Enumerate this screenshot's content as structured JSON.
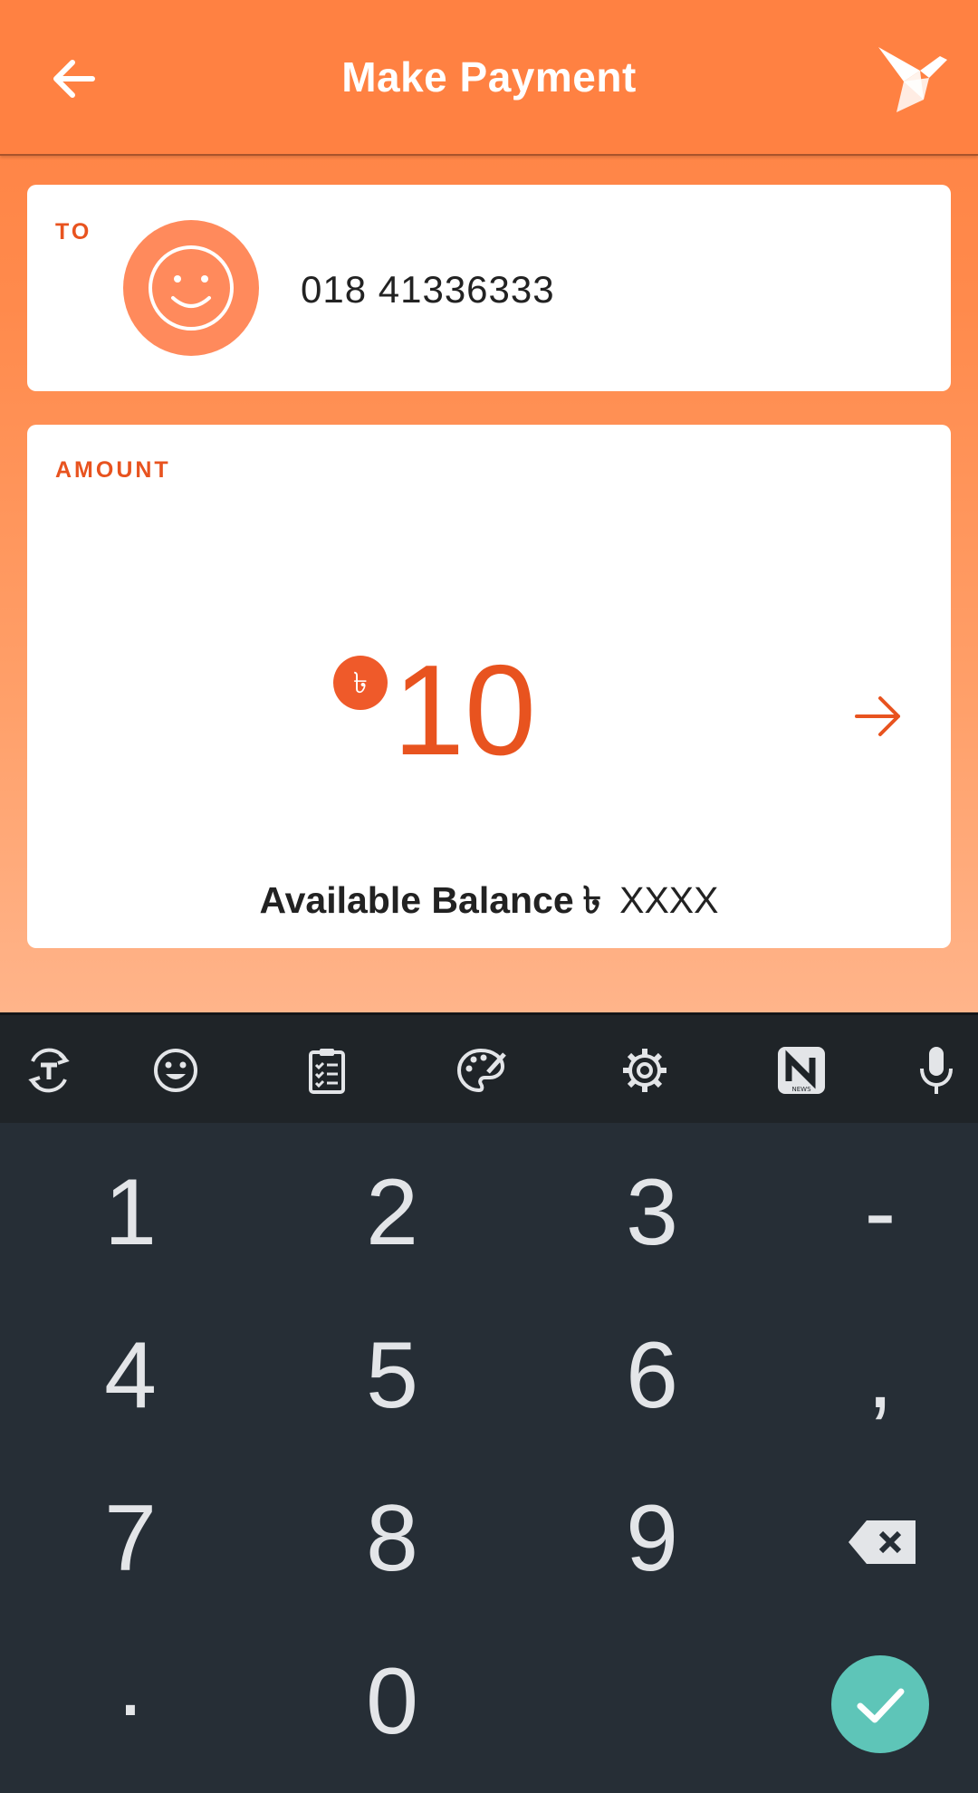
{
  "header": {
    "title": "Make Payment"
  },
  "to_card": {
    "label": "TO",
    "phone": "018 41336333"
  },
  "amount_card": {
    "label": "AMOUNT",
    "currency_symbol": "৳",
    "amount": "10",
    "balance_label": "Available Balance",
    "balance_currency": "৳",
    "balance_value": "XXXX"
  },
  "keyboard": {
    "toolbar_icons": [
      "translate-icon",
      "emoji-icon",
      "clipboard-icon",
      "palette-icon",
      "settings-icon",
      "news-icon",
      "microphone-icon"
    ],
    "keys": {
      "k1": "1",
      "k2": "2",
      "k3": "3",
      "dash": "-",
      "k4": "4",
      "k5": "5",
      "k6": "6",
      "comma": ",",
      "k7": "7",
      "k8": "8",
      "k9": "9",
      "dot": ".",
      "k0": "0"
    }
  },
  "colors": {
    "brand": "#ff8142",
    "accent": "#e8531f",
    "done": "#5ec5b8"
  }
}
